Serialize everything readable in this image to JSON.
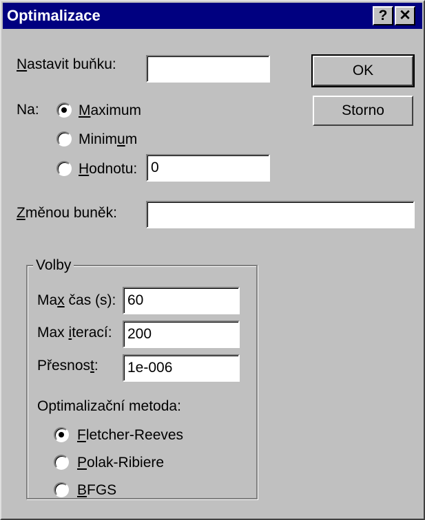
{
  "dialog": {
    "title": "Optimalizace",
    "help_glyph": "?",
    "close_glyph": "✕"
  },
  "target": {
    "label_prefix": "N",
    "label_rest": "astavit buňku:",
    "value": ""
  },
  "to": {
    "label": "Na:",
    "maximum_u": "M",
    "maximum_rest": "aximum",
    "minimum_pre": "Minim",
    "minimum_u": "u",
    "minimum_post": "m",
    "value_u": "H",
    "value_rest": "odnotu:",
    "value_input": "0",
    "selected": "maximum"
  },
  "changing": {
    "label_u": "Z",
    "label_rest": "měnou buněk:",
    "value": ""
  },
  "buttons": {
    "ok": "OK",
    "cancel": "Storno"
  },
  "options": {
    "group_title": "Volby",
    "max_time_pre": "Ma",
    "max_time_u": "x",
    "max_time_post": " čas (s):",
    "max_time_value": "60",
    "max_iter_pre": "Max ",
    "max_iter_u": "i",
    "max_iter_post": "terací:",
    "max_iter_value": "200",
    "precision_pre": "Přesnos",
    "precision_u": "t",
    "precision_post": ":",
    "precision_value": "1e-006",
    "method_label": "Optimalizační metoda:",
    "methods": [
      {
        "u": "F",
        "rest": "letcher-Reeves",
        "selected": true
      },
      {
        "u": "P",
        "rest": "olak-Ribiere",
        "selected": false
      },
      {
        "u": "B",
        "rest": "FGS",
        "selected": false
      }
    ]
  }
}
